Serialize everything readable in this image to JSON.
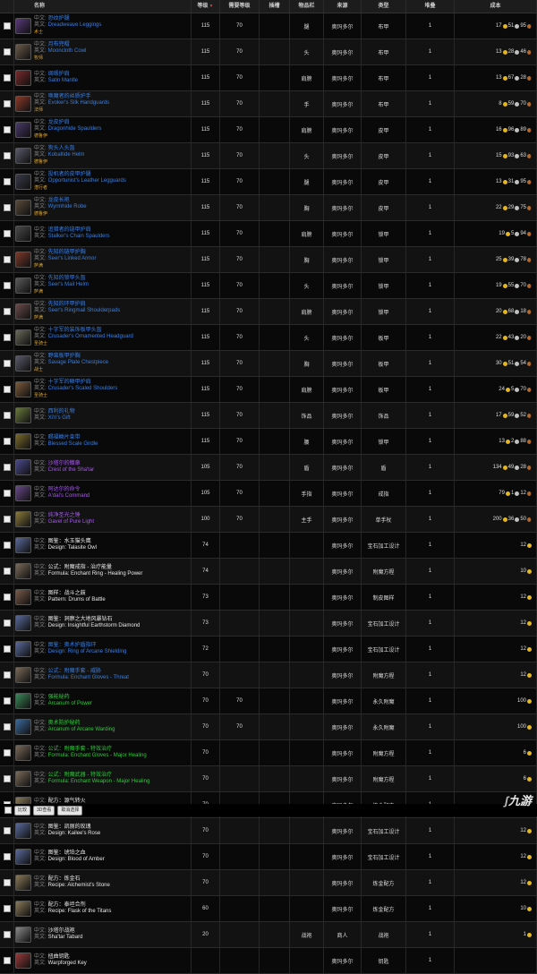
{
  "header": {
    "name": "名称",
    "level": "等级",
    "required_level": "需要等级",
    "slot": "插槽",
    "item_position": "物品栏",
    "source": "来源",
    "type": "类型",
    "stack": "堆叠",
    "cost": "成本"
  },
  "labels": {
    "zh": "中文:",
    "en": "英文:"
  },
  "rows": [
    {
      "zh": "恐纹护腿",
      "en": "Dreadweave Leggings",
      "sub": "术士",
      "level": "115",
      "req": "70",
      "slot": "",
      "pos": "腿",
      "src": "奥玛多尔",
      "type": "布甲",
      "stack": "1",
      "cost_g": "17",
      "cost_s": "51",
      "cost_c": "95",
      "quality": "blue",
      "icon_color": "#5a3a7a"
    },
    {
      "zh": "月布兜帽",
      "en": "Mooncloth Cowl",
      "sub": "牧师",
      "level": "115",
      "req": "70",
      "slot": "",
      "pos": "头",
      "src": "奥玛多尔",
      "type": "布甲",
      "stack": "1",
      "cost_g": "13",
      "cost_s": "28",
      "cost_c": "46",
      "quality": "blue",
      "icon_color": "#6a5a4a"
    },
    {
      "zh": "绸缎护肩",
      "en": "Satin Mantle",
      "sub": "",
      "level": "115",
      "req": "70",
      "slot": "",
      "pos": "肩膀",
      "src": "奥玛多尔",
      "type": "布甲",
      "stack": "1",
      "cost_g": "13",
      "cost_s": "67",
      "cost_c": "28",
      "quality": "blue",
      "icon_color": "#7a2a2a"
    },
    {
      "zh": "唤魔者的丝质护手",
      "en": "Evoker's Silk Handguards",
      "sub": "法师",
      "level": "115",
      "req": "70",
      "slot": "",
      "pos": "手",
      "src": "奥玛多尔",
      "type": "布甲",
      "stack": "1",
      "cost_g": "8",
      "cost_s": "59",
      "cost_c": "70",
      "quality": "blue",
      "icon_color": "#8a3a2a"
    },
    {
      "zh": "龙皮护肩",
      "en": "Dragonhide Spaulders",
      "sub": "德鲁伊",
      "level": "115",
      "req": "70",
      "slot": "",
      "pos": "肩膀",
      "src": "奥玛多尔",
      "type": "皮甲",
      "stack": "1",
      "cost_g": "16",
      "cost_s": "96",
      "cost_c": "89",
      "quality": "blue",
      "icon_color": "#4a3a6a"
    },
    {
      "zh": "狗头人头盔",
      "en": "Kobaltide Helm",
      "sub": "德鲁伊",
      "level": "115",
      "req": "70",
      "slot": "",
      "pos": "头",
      "src": "奥玛多尔",
      "type": "皮甲",
      "stack": "1",
      "cost_g": "15",
      "cost_s": "93",
      "cost_c": "63",
      "quality": "blue",
      "icon_color": "#5a5a6a"
    },
    {
      "zh": "投机者的皮甲护腿",
      "en": "Opportunist's Leather Legguards",
      "sub": "潜行者",
      "level": "115",
      "req": "70",
      "slot": "",
      "pos": "腿",
      "src": "奥玛多尔",
      "type": "皮甲",
      "stack": "1",
      "cost_g": "13",
      "cost_s": "31",
      "cost_c": "95",
      "quality": "blue",
      "icon_color": "#3a3a4a"
    },
    {
      "zh": "龙皮长袍",
      "en": "Wyrmhide Robe",
      "sub": "德鲁伊",
      "level": "115",
      "req": "70",
      "slot": "",
      "pos": "胸",
      "src": "奥玛多尔",
      "type": "皮甲",
      "stack": "1",
      "cost_g": "22",
      "cost_s": "29",
      "cost_c": "75",
      "quality": "blue",
      "icon_color": "#5a4a3a"
    },
    {
      "zh": "追猎者的链甲护肩",
      "en": "Stalker's Chain Spaulders",
      "sub": "",
      "level": "115",
      "req": "70",
      "slot": "",
      "pos": "肩膀",
      "src": "奥玛多尔",
      "type": "锁甲",
      "stack": "1",
      "cost_g": "19",
      "cost_s": "5",
      "cost_c": "94",
      "quality": "blue",
      "icon_color": "#4a4a4a"
    },
    {
      "zh": "先知的链甲护胸",
      "en": "Seer's Linked Armor",
      "sub": "萨满",
      "level": "115",
      "req": "70",
      "slot": "",
      "pos": "胸",
      "src": "奥玛多尔",
      "type": "锁甲",
      "stack": "1",
      "cost_g": "25",
      "cost_s": "39",
      "cost_c": "78",
      "quality": "blue",
      "icon_color": "#7a3a2a"
    },
    {
      "zh": "先知的锁甲头盔",
      "en": "Seer's Mail Helm",
      "sub": "萨满",
      "level": "115",
      "req": "70",
      "slot": "",
      "pos": "头",
      "src": "奥玛多尔",
      "type": "锁甲",
      "stack": "1",
      "cost_g": "19",
      "cost_s": "55",
      "cost_c": "70",
      "quality": "blue",
      "icon_color": "#5a5a5a"
    },
    {
      "zh": "先知的环甲护肩",
      "en": "Seer's Ringmail Shoulderpads",
      "sub": "萨满",
      "level": "115",
      "req": "70",
      "slot": "",
      "pos": "肩膀",
      "src": "奥玛多尔",
      "type": "锁甲",
      "stack": "1",
      "cost_g": "20",
      "cost_s": "68",
      "cost_c": "18",
      "quality": "blue",
      "icon_color": "#6a4a4a"
    },
    {
      "zh": "十字军的装饰板甲头盔",
      "en": "Crusader's Ornamented Headguard",
      "sub": "圣骑士",
      "level": "115",
      "req": "70",
      "slot": "",
      "pos": "头",
      "src": "奥玛多尔",
      "type": "板甲",
      "stack": "1",
      "cost_g": "22",
      "cost_s": "43",
      "cost_c": "20",
      "quality": "blue",
      "icon_color": "#6a6a5a"
    },
    {
      "zh": "野蛮板甲护胸",
      "en": "Savage Plate Chestpiece",
      "sub": "战士",
      "level": "115",
      "req": "70",
      "slot": "",
      "pos": "胸",
      "src": "奥玛多尔",
      "type": "板甲",
      "stack": "1",
      "cost_g": "30",
      "cost_s": "51",
      "cost_c": "54",
      "quality": "blue",
      "icon_color": "#5a5a6a"
    },
    {
      "zh": "十字军的鳞甲护肩",
      "en": "Crusader's Scaled Shoulders",
      "sub": "圣骑士",
      "level": "115",
      "req": "70",
      "slot": "",
      "pos": "肩膀",
      "src": "奥玛多尔",
      "type": "板甲",
      "stack": "1",
      "cost_g": "24",
      "cost_s": "5",
      "cost_c": "70",
      "quality": "blue",
      "icon_color": "#7a5a3a"
    },
    {
      "zh": "西利的礼物",
      "en": "Xi'ri's Gift",
      "sub": "",
      "level": "115",
      "req": "70",
      "slot": "",
      "pos": "饰品",
      "src": "奥玛多尔",
      "type": "饰品",
      "stack": "1",
      "cost_g": "17",
      "cost_s": "59",
      "cost_c": "52",
      "quality": "blue",
      "icon_color": "#6a7a3a"
    },
    {
      "zh": "赐福鳞片束带",
      "en": "Blessed Scale Girdle",
      "sub": "",
      "level": "115",
      "req": "70",
      "slot": "",
      "pos": "腰",
      "src": "奥玛多尔",
      "type": "锁甲",
      "stack": "1",
      "cost_g": "13",
      "cost_s": "2",
      "cost_c": "88",
      "quality": "blue",
      "icon_color": "#7a6a2a"
    },
    {
      "zh": "沙塔尔的徽章",
      "en": "Crest of the Sha'tar",
      "sub": "",
      "level": "105",
      "req": "70",
      "slot": "",
      "pos": "盾",
      "src": "奥玛多尔",
      "type": "盾",
      "stack": "1",
      "cost_g": "134",
      "cost_s": "49",
      "cost_c": "28",
      "quality": "purple",
      "icon_color": "#4a4a8a"
    },
    {
      "zh": "阿达尔的命令",
      "en": "A'dal's Command",
      "sub": "",
      "level": "105",
      "req": "70",
      "slot": "",
      "pos": "手指",
      "src": "奥玛多尔",
      "type": "戒指",
      "stack": "1",
      "cost_g": "79",
      "cost_s": "1",
      "cost_c": "12",
      "quality": "purple",
      "icon_color": "#6a4a8a"
    },
    {
      "zh": "纯净圣光之锤",
      "en": "Gavel of Pure Light",
      "sub": "",
      "level": "100",
      "req": "70",
      "slot": "",
      "pos": "主手",
      "src": "奥玛多尔",
      "type": "单手杖",
      "stack": "1",
      "cost_g": "200",
      "cost_s": "36",
      "cost_c": "50",
      "quality": "purple",
      "icon_color": "#8a7a3a"
    },
    {
      "zh": "图鉴：水玉猫头鹰",
      "en": "Design: Talasite Owl",
      "sub": "",
      "level": "74",
      "req": "",
      "slot": "",
      "pos": "",
      "src": "奥玛多尔",
      "type": "宝石加工设计",
      "stack": "1",
      "cost_g": "12",
      "cost_s": "",
      "cost_c": "",
      "quality": "white",
      "icon_color": "#5a6a9a"
    },
    {
      "zh": "公式：附魔戒指 - 治疗能量",
      "en": "Formula: Enchant Ring - Healing Power",
      "sub": "",
      "level": "74",
      "req": "",
      "slot": "",
      "pos": "",
      "src": "奥玛多尔",
      "type": "附魔方程",
      "stack": "1",
      "cost_g": "10",
      "cost_s": "",
      "cost_c": "",
      "quality": "white",
      "icon_color": "#7a6a5a"
    },
    {
      "zh": "图样：战斗之鼓",
      "en": "Pattern: Drums of Battle",
      "sub": "",
      "level": "73",
      "req": "",
      "slot": "",
      "pos": "",
      "src": "奥玛多尔",
      "type": "制皮图样",
      "stack": "1",
      "cost_g": "12",
      "cost_s": "",
      "cost_c": "",
      "quality": "white",
      "icon_color": "#7a5a4a"
    },
    {
      "zh": "图鉴：洞察之大地风暴钻石",
      "en": "Design: Insightful Earthstorm Diamond",
      "sub": "",
      "level": "73",
      "req": "",
      "slot": "",
      "pos": "",
      "src": "奥玛多尔",
      "type": "宝石加工设计",
      "stack": "1",
      "cost_g": "12",
      "cost_s": "",
      "cost_c": "",
      "quality": "white",
      "icon_color": "#5a6a9a"
    },
    {
      "zh": "图鉴：奥术护盾指环",
      "en": "Design: Ring of Arcane Shielding",
      "sub": "",
      "level": "72",
      "req": "",
      "slot": "",
      "pos": "",
      "src": "奥玛多尔",
      "type": "宝石加工设计",
      "stack": "1",
      "cost_g": "12",
      "cost_s": "",
      "cost_c": "",
      "quality": "blue",
      "icon_color": "#5a6a9a"
    },
    {
      "zh": "公式：附魔手套 - 威胁",
      "en": "Formula: Enchant Gloves - Threat",
      "sub": "",
      "level": "70",
      "req": "",
      "slot": "",
      "pos": "",
      "src": "奥玛多尔",
      "type": "附魔方程",
      "stack": "1",
      "cost_g": "12",
      "cost_s": "",
      "cost_c": "",
      "quality": "blue",
      "icon_color": "#7a6a5a"
    },
    {
      "zh": "强能秘药",
      "en": "Arcanum of Power",
      "sub": "",
      "level": "70",
      "req": "70",
      "slot": "",
      "pos": "",
      "src": "奥玛多尔",
      "type": "永久附魔",
      "stack": "1",
      "cost_g": "100",
      "cost_s": "",
      "cost_c": "",
      "quality": "green",
      "icon_color": "#3a8a5a"
    },
    {
      "zh": "奥术防护秘药",
      "en": "Arcanum of Arcane Warding",
      "sub": "",
      "level": "70",
      "req": "70",
      "slot": "",
      "pos": "",
      "src": "奥玛多尔",
      "type": "永久附魔",
      "stack": "1",
      "cost_g": "100",
      "cost_s": "",
      "cost_c": "",
      "quality": "green",
      "icon_color": "#3a6a9a"
    },
    {
      "zh": "公式：附魔手套 - 特效治疗",
      "en": "Formula: Enchant Gloves - Major Healing",
      "sub": "",
      "level": "70",
      "req": "",
      "slot": "",
      "pos": "",
      "src": "奥玛多尔",
      "type": "附魔方程",
      "stack": "1",
      "cost_g": "6",
      "cost_s": "",
      "cost_c": "",
      "quality": "green",
      "icon_color": "#7a6a5a"
    },
    {
      "zh": "公式：附魔武器 - 特效治疗",
      "en": "Formula: Enchant Weapon - Major Healing",
      "sub": "",
      "level": "70",
      "req": "",
      "slot": "",
      "pos": "",
      "src": "奥玛多尔",
      "type": "附魔方程",
      "stack": "1",
      "cost_g": "6",
      "cost_s": "",
      "cost_c": "",
      "quality": "green",
      "icon_color": "#7a6a5a"
    },
    {
      "zh": "配方：源气转火",
      "en": "Recipe: Transmute Primal Air to Fire",
      "sub": "",
      "level": "70",
      "req": "",
      "slot": "",
      "pos": "",
      "src": "奥玛多尔",
      "type": "炼金配方",
      "stack": "1",
      "cost_g": "12",
      "cost_s": "",
      "cost_c": "",
      "quality": "white",
      "icon_color": "#8a7a5a"
    },
    {
      "zh": "图鉴：凯丽的玫瑰",
      "en": "Design: Kailee's Rose",
      "sub": "",
      "level": "70",
      "req": "",
      "slot": "",
      "pos": "",
      "src": "奥玛多尔",
      "type": "宝石加工设计",
      "stack": "1",
      "cost_g": "12",
      "cost_s": "",
      "cost_c": "",
      "quality": "white",
      "icon_color": "#5a6a9a"
    },
    {
      "zh": "图鉴：琥珀之血",
      "en": "Design: Blood of Amber",
      "sub": "",
      "level": "70",
      "req": "",
      "slot": "",
      "pos": "",
      "src": "奥玛多尔",
      "type": "宝石加工设计",
      "stack": "1",
      "cost_g": "12",
      "cost_s": "",
      "cost_c": "",
      "quality": "white",
      "icon_color": "#5a6a9a"
    },
    {
      "zh": "配方：炼金石",
      "en": "Recipe: Alchemist's Stone",
      "sub": "",
      "level": "70",
      "req": "",
      "slot": "",
      "pos": "",
      "src": "奥玛多尔",
      "type": "炼金配方",
      "stack": "1",
      "cost_g": "12",
      "cost_s": "",
      "cost_c": "",
      "quality": "white",
      "icon_color": "#8a7a5a"
    },
    {
      "zh": "配方：泰坦合剂",
      "en": "Recipe: Flask of the Titans",
      "sub": "",
      "level": "60",
      "req": "",
      "slot": "",
      "pos": "",
      "src": "奥玛多尔",
      "type": "炼金配方",
      "stack": "1",
      "cost_g": "10",
      "cost_s": "",
      "cost_c": "",
      "quality": "white",
      "icon_color": "#8a7a5a"
    },
    {
      "zh": "沙塔尔战袍",
      "en": "Sha'tar Tabard",
      "sub": "",
      "level": "20",
      "req": "",
      "slot": "",
      "pos": "战袍",
      "src": "商人",
      "type": "战袍",
      "stack": "1",
      "cost_g": "1",
      "cost_s": "",
      "cost_c": "",
      "quality": "white",
      "icon_color": "#8a8a8a"
    },
    {
      "zh": "扭曲钥匙",
      "en": "Warpforged Key",
      "sub": "",
      "level": "",
      "req": "",
      "slot": "",
      "pos": "",
      "src": "奥玛多尔",
      "type": "钥匙",
      "stack": "1",
      "cost_g": "",
      "cost_s": "",
      "cost_c": "",
      "quality": "white",
      "icon_color": "#9a3a3a"
    }
  ],
  "footer": {
    "compare_label": "比较",
    "threed_label": "3D查看",
    "deselect_label": "取消选择"
  },
  "logo": {
    "text": "九游"
  }
}
